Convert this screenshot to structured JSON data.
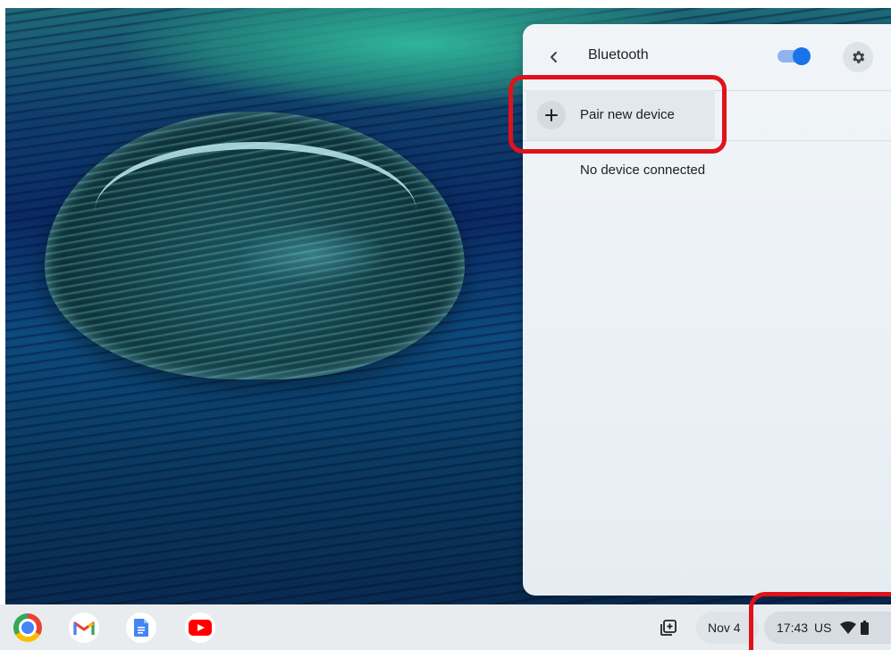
{
  "bluetooth_panel": {
    "back_icon": "chevron-left-icon",
    "title": "Bluetooth",
    "toggle_state": "on",
    "settings_icon": "gear-icon",
    "pair_icon": "plus-icon",
    "pair_label": "Pair new device",
    "status_text": "No device connected"
  },
  "shelf": {
    "apps": [
      {
        "name": "Chrome",
        "icon": "chrome-icon"
      },
      {
        "name": "Gmail",
        "icon": "gmail-icon"
      },
      {
        "name": "Docs",
        "icon": "docs-icon"
      },
      {
        "name": "YouTube",
        "icon": "youtube-icon"
      }
    ],
    "holding_space_icon": "screen-capture-icon",
    "date": "Nov 4",
    "time": "17:43",
    "keyboard_layout": "US",
    "wifi_icon": "wifi-icon",
    "battery_icon": "battery-icon"
  },
  "colors": {
    "accent": "#1a73e8",
    "highlight": "#e0121a"
  }
}
